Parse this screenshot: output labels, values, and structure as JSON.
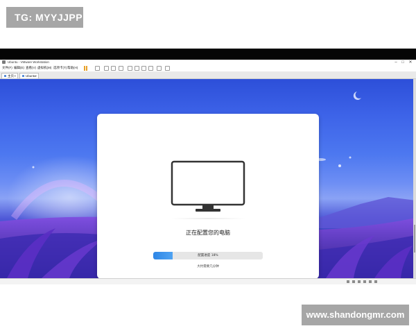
{
  "watermark_top": "TG: MYYJJPP",
  "watermark_bottom": "www.shandongmr.com",
  "window": {
    "title": "Ubuntu - VMware Workstation",
    "controls": [
      "–",
      "□",
      "✕"
    ]
  },
  "menubar": {
    "items": [
      "文件(F)",
      "编辑(E)",
      "查看(V)",
      "虚拟机(M)",
      "选项卡(T)",
      "帮助(H)"
    ]
  },
  "tabs": [
    {
      "label": "主页",
      "close": "×"
    },
    {
      "label": "Ubuntu",
      "close": "×"
    }
  ],
  "setup": {
    "heading": "正在配置您的电脑",
    "progress_label": "配置进度 18%",
    "progress_value": 0.18,
    "time_remaining": "大约需要几分钟"
  },
  "colors": {
    "accent": "#2e86e6",
    "pause": "#e8a12a"
  },
  "icons": {
    "monitor": "monitor-icon",
    "pause": "pause-icon"
  }
}
